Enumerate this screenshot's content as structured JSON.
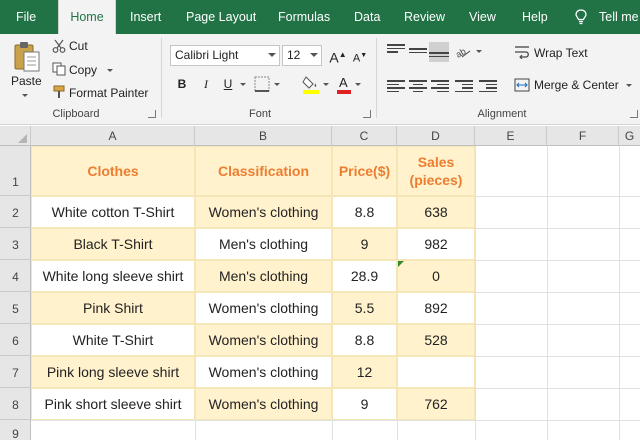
{
  "menubar": {
    "tabs": [
      "File",
      "Home",
      "Insert",
      "Page Layout",
      "Formulas",
      "Data",
      "Review",
      "View",
      "Help"
    ],
    "tell_me": "Tell me"
  },
  "ribbon": {
    "clipboard": {
      "paste": "Paste",
      "cut": "Cut",
      "copy": "Copy",
      "format_painter": "Format Painter",
      "label": "Clipboard"
    },
    "font": {
      "name": "Calibri Light",
      "size": "12",
      "bold": "B",
      "italic": "I",
      "underline": "U",
      "grow": "A",
      "shrink": "A",
      "label": "Font"
    },
    "alignment": {
      "wrap_text": "Wrap Text",
      "merge_center": "Merge & Center",
      "label": "Alignment"
    }
  },
  "grid": {
    "columns": [
      "A",
      "B",
      "C",
      "D",
      "E",
      "F",
      "G"
    ],
    "rows": [
      "1",
      "2",
      "3",
      "4",
      "5",
      "6",
      "7",
      "8",
      "9"
    ],
    "headers": {
      "a": "Clothes",
      "b": "Classification",
      "c": "Price($)",
      "d_line1": "Sales",
      "d_line2": "(pieces)"
    },
    "data": [
      {
        "a": "White cotton T-Shirt",
        "b": "Women's clothing",
        "c": "8.8",
        "d": "638"
      },
      {
        "a": "Black T-Shirt",
        "b": "Men's clothing",
        "c": "9",
        "d": "982"
      },
      {
        "a": "White long sleeve shirt",
        "b": "Men's clothing",
        "c": "28.9",
        "d": "0"
      },
      {
        "a": "Pink Shirt",
        "b": "Women's clothing",
        "c": "5.5",
        "d": "892"
      },
      {
        "a": "White T-Shirt",
        "b": "Women's clothing",
        "c": "8.8",
        "d": "528"
      },
      {
        "a": "Pink long sleeve shirt",
        "b": "Women's clothing",
        "c": "12",
        "d": ""
      },
      {
        "a": "Pink short sleeve shirt",
        "b": "Women's clothing",
        "c": "9",
        "d": "762"
      }
    ]
  },
  "colors": {
    "brand": "#217346",
    "header_text": "#ed7d31",
    "cell_fill": "#fff2cc"
  }
}
